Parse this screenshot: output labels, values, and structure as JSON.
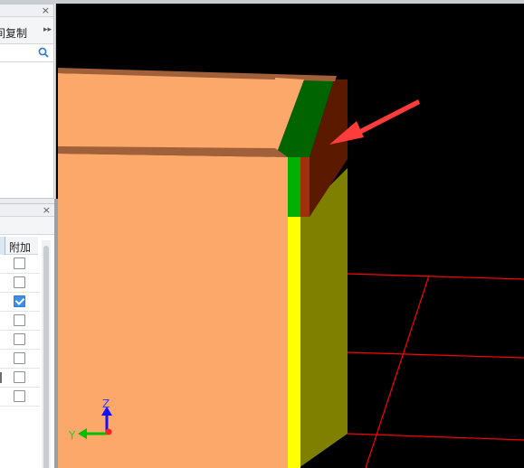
{
  "top_panel": {
    "close_glyph": "×",
    "copy_label": "间复制",
    "more_glyph": "▸▸",
    "search_icon": "search-icon"
  },
  "bottom_panel": {
    "close_glyph": "×",
    "column_header": "附加",
    "rows": [
      {
        "checked": false
      },
      {
        "checked": false
      },
      {
        "checked": true
      },
      {
        "checked": false
      },
      {
        "checked": false
      },
      {
        "checked": false
      },
      {
        "checked": false
      },
      {
        "checked": false
      }
    ]
  },
  "viewport": {
    "axis_z_label": "Z",
    "axis_y_label": "Y",
    "colors": {
      "background": "#000000",
      "wall_face": "#fca86a",
      "slab_edge": "#a0603a",
      "wall_side": "#808000",
      "highlight_green": "#006400",
      "highlight_red": "#5b1a00",
      "yellow_strip": "#ffff00",
      "green_strip": "#00b000",
      "grid_line": "#ff0000",
      "arrow": "#ff3c3c"
    }
  }
}
